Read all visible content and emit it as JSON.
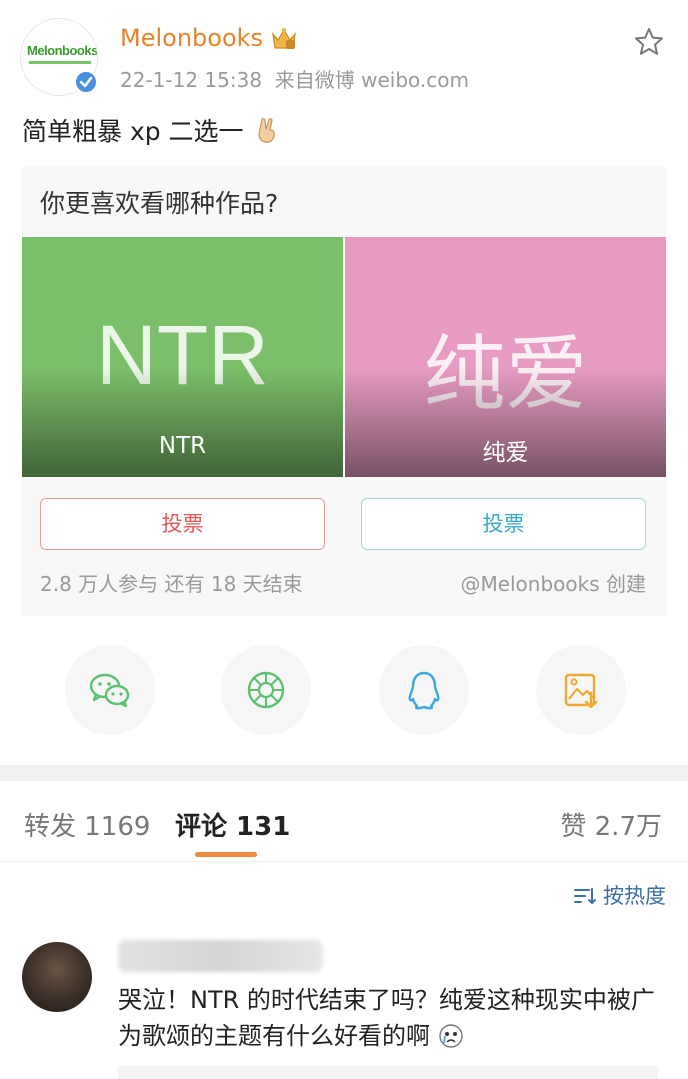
{
  "post": {
    "avatar_text": "Melonbooks",
    "username": "Melonbooks",
    "timestamp": "22-1-12 15:38",
    "source": "来自微博 weibo.com",
    "text": "简单粗暴 xp 二选一"
  },
  "poll": {
    "question": "你更喜欢看哪种作品?",
    "options": [
      {
        "image_text": "NTR",
        "label": "NTR",
        "vote_label": "投票",
        "color": "#7cbf6a",
        "accent": "#e05a5a"
      },
      {
        "image_text": "纯爱",
        "label": "纯爱",
        "vote_label": "投票",
        "color": "#e79bc3",
        "accent": "#3aa8c8"
      }
    ],
    "stats": "2.8 万人参与   还有 18 天结束",
    "creator": "@Melonbooks 创建"
  },
  "share": {
    "items": [
      "wechat-icon",
      "moments-icon",
      "qq-icon",
      "save-image-icon"
    ],
    "colors": [
      "#5cc072",
      "#5cc072",
      "#3aa8e0",
      "#f0a830"
    ]
  },
  "tabs": {
    "repost": "转发 1169",
    "comments": "评论 131",
    "likes": "赞 2.7万"
  },
  "sort": {
    "label": "按热度"
  },
  "comments": [
    {
      "text": "哭泣！NTR 的时代结束了吗？纯爱这种现实中被广为歌颂的主题有什么好看的啊"
    }
  ]
}
